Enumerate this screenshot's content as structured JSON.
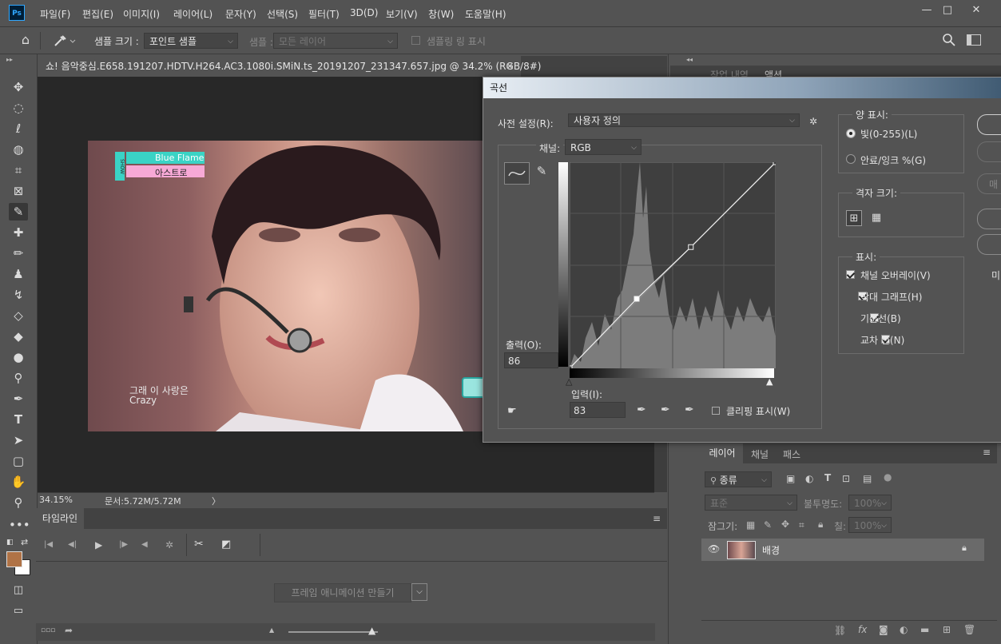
{
  "app": {
    "logo": "Ps"
  },
  "menu": [
    "파일(F)",
    "편집(E)",
    "이미지(I)",
    "레이어(L)",
    "문자(Y)",
    "선택(S)",
    "필터(T)",
    "3D(D)",
    "보기(V)",
    "창(W)",
    "도움말(H)"
  ],
  "window_controls": {
    "minimize": "—",
    "restore": "□",
    "close": "✕"
  },
  "options": {
    "sample_size_label": "샘플 크기 :",
    "sample_size_value": "포인트 샘플",
    "sample_label": "샘플 :",
    "sample_value": "모든 레이어",
    "show_ring_label": "샘플링 링 표시"
  },
  "document": {
    "tab_title": "쇼! 음악중심.E658.191207.HDTV.H264.AC3.1080i.SMiN.ts_20191207_231347.657.jpg @ 34.2% (RGB/8#)",
    "close": "✕",
    "overlay": {
      "show_label": "SHOW",
      "song": "Blue Flame",
      "artist": "아스트로",
      "subtitle_ko": "그래 이 사랑은",
      "subtitle_en": "Crazy"
    }
  },
  "status": {
    "zoom": "34.15%",
    "doc": "문서:5.72M/5.72M",
    "arrow": "〉"
  },
  "timeline": {
    "tab": "타임라인",
    "create_button": "프레임 애니메이션 만들기"
  },
  "right_panel": {
    "top_tabs": [
      "작업 내역",
      "액션"
    ]
  },
  "layers": {
    "tabs": [
      "레이어",
      "채널",
      "패스"
    ],
    "filter_kind": "종류",
    "blend_mode": "표준",
    "opacity_label": "불투명도:",
    "opacity_value": "100%",
    "lock_label": "잠그기:",
    "fill_label": "칠:",
    "fill_value": "100%",
    "layer_name": "배경",
    "footer_icons": [
      "link-icon",
      "fx",
      "mask-icon",
      "adjustment-icon",
      "folder-icon",
      "new-layer-icon",
      "trash-icon"
    ]
  },
  "curves": {
    "title": "곡선",
    "preset_label": "사전 설정(R):",
    "preset_value": "사용자 정의",
    "channel_label": "채널:",
    "channel_value": "RGB",
    "output_label": "출력(O):",
    "output_value": "86",
    "input_label": "입력(I):",
    "input_value": "83",
    "show_clipping_label": "클리핑 표시(W)",
    "amount_title": "양 표시:",
    "light_label": "빛(0-255)(L)",
    "pigment_label": "안료/잉크 %(G)",
    "grid_title": "격자 크기:",
    "display_title": "표시:",
    "display_options": [
      "채널 오버레이(V)",
      "막대 그래프(H)",
      "기준선(B)",
      "교차 선(N)"
    ],
    "right_partial": [
      "매",
      "미"
    ]
  }
}
